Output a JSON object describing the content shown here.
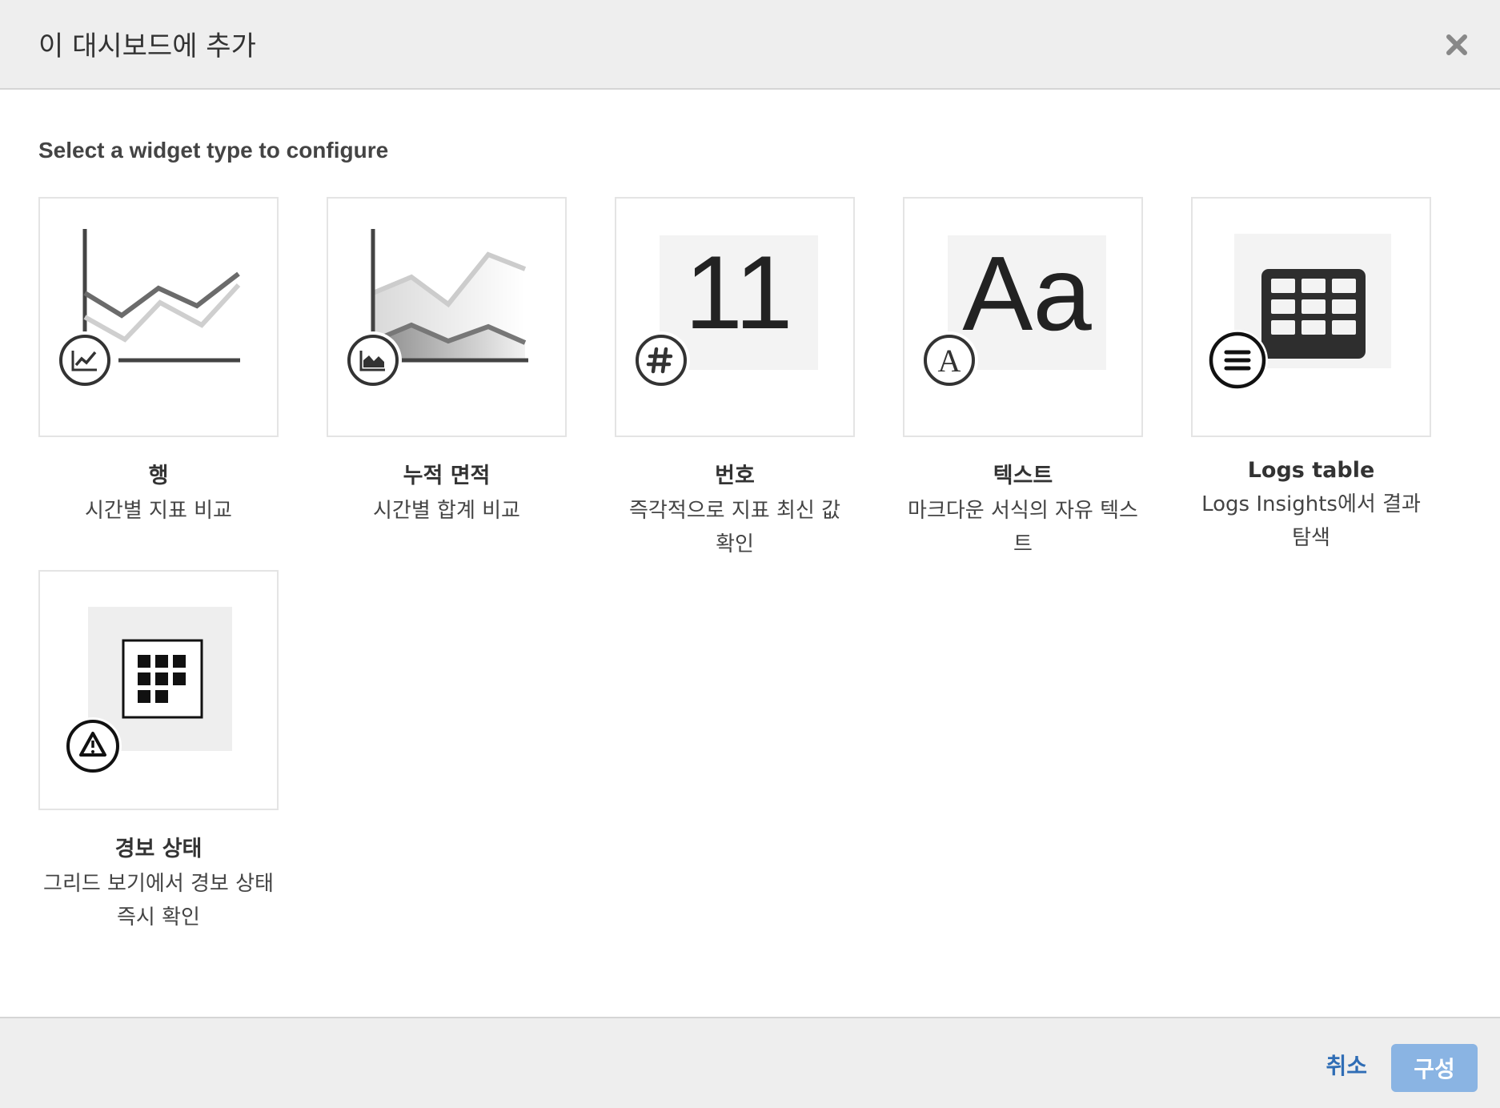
{
  "header": {
    "title": "이 대시보드에 추가",
    "close_icon": "close-icon"
  },
  "body": {
    "heading": "Select a widget type to configure"
  },
  "widgets": [
    {
      "name": "행",
      "description": "시간별 지표 비교",
      "icon": "line-chart-icon"
    },
    {
      "name": "누적 면적",
      "description": "시간별 합계 비교",
      "icon": "area-chart-icon"
    },
    {
      "name": "번호",
      "description": "즉각적으로 지표 최신 값 확인",
      "icon": "hash-icon",
      "preview_text": "11"
    },
    {
      "name": "텍스트",
      "description": "마크다운 서식의 자유 텍스트",
      "icon": "text-a-icon",
      "preview_text": "Aa",
      "badge_text": "A"
    },
    {
      "name": "Logs table",
      "description": "Logs Insights에서 결과 탐색",
      "icon": "list-icon"
    },
    {
      "name": "경보 상태",
      "description": "그리드 보기에서 경보 상태 즉시 확인",
      "icon": "warning-icon"
    }
  ],
  "footer": {
    "cancel_label": "취소",
    "configure_label": "구성"
  },
  "colors": {
    "header_bg": "#eeeeee",
    "primary_disabled": "#8ab4e3",
    "link": "#2f6db5"
  }
}
